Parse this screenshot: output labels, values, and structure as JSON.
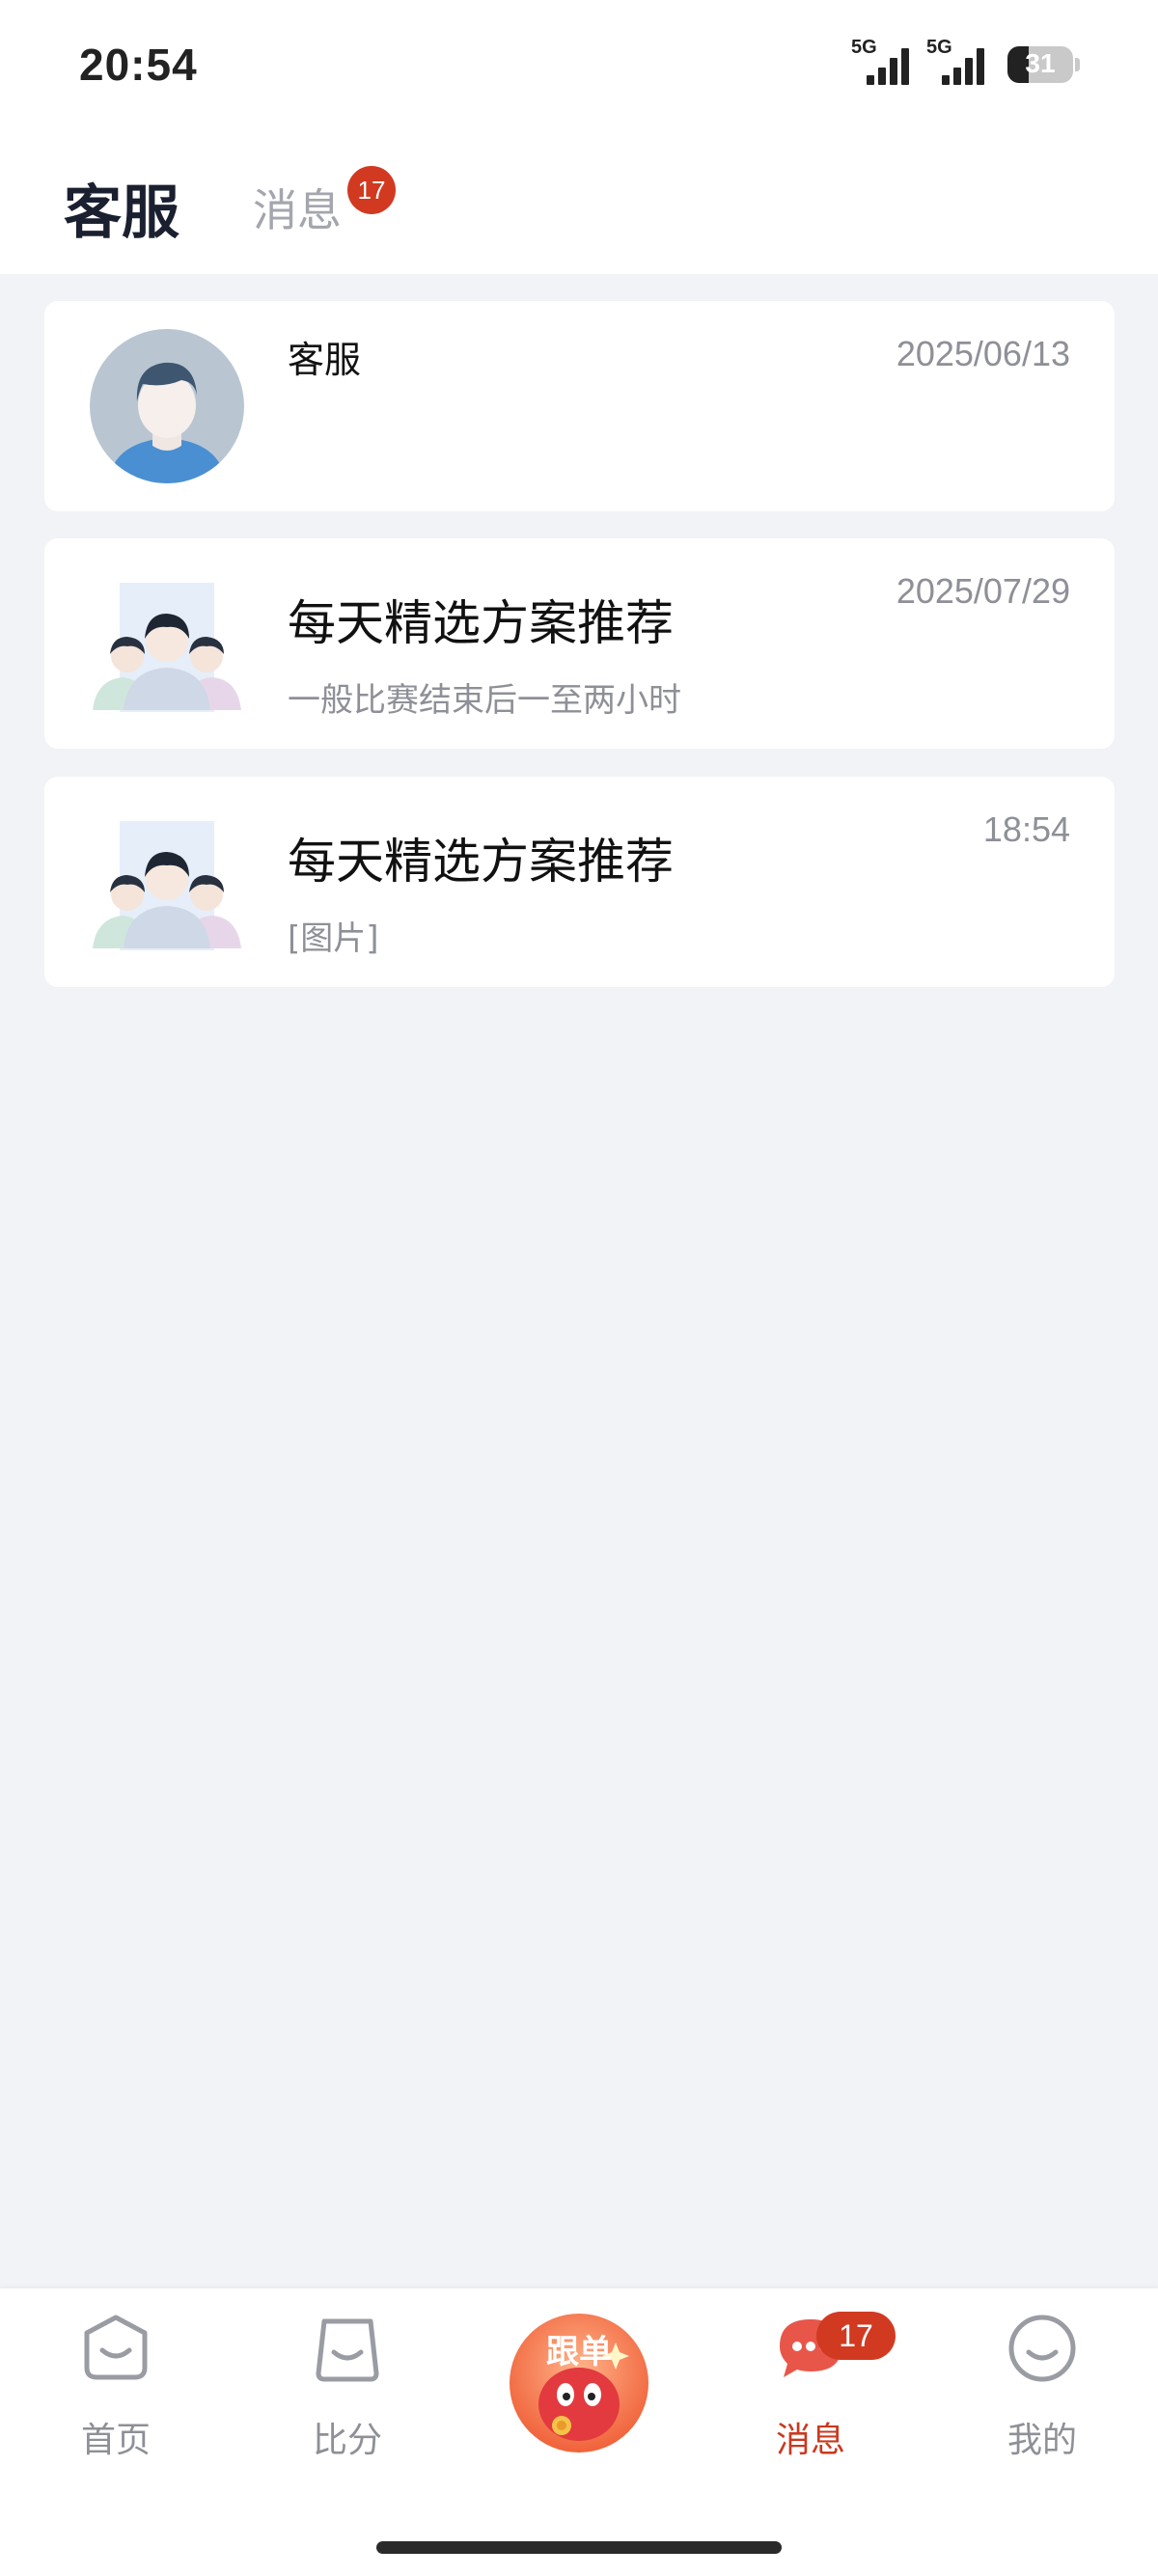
{
  "status_bar": {
    "time": "20:54",
    "signal_1_label": "5G",
    "signal_2_label": "5G",
    "battery": "31"
  },
  "tabs": {
    "active_label": "客服",
    "inactive_label": "消息",
    "badge": "17"
  },
  "conversations": [
    {
      "title": "客服",
      "subtitle": "",
      "time": "2025/06/13",
      "avatar": "person-avatar-icon"
    },
    {
      "title": "每天精选方案推荐",
      "subtitle": "一般比赛结束后一至两小时",
      "time": "2025/07/29",
      "avatar": "group-avatar-icon"
    },
    {
      "title": "每天精选方案推荐",
      "subtitle": "[图片]",
      "time": "18:54",
      "avatar": "group-avatar-icon"
    }
  ],
  "bottom_nav": {
    "items": [
      {
        "label": "首页",
        "icon": "home-face-icon",
        "active": false
      },
      {
        "label": "比分",
        "icon": "score-bag-icon",
        "active": false
      },
      {
        "label": "跟单",
        "icon": "mascot-icon",
        "active": false
      },
      {
        "label": "消息",
        "icon": "chat-bubble-icon",
        "active": true
      },
      {
        "label": "我的",
        "icon": "profile-face-icon",
        "active": false
      }
    ],
    "message_badge": "17"
  },
  "colors": {
    "accent": "#d13a21",
    "page_bg": "#f2f3f7",
    "muted_text": "#8e9097"
  }
}
